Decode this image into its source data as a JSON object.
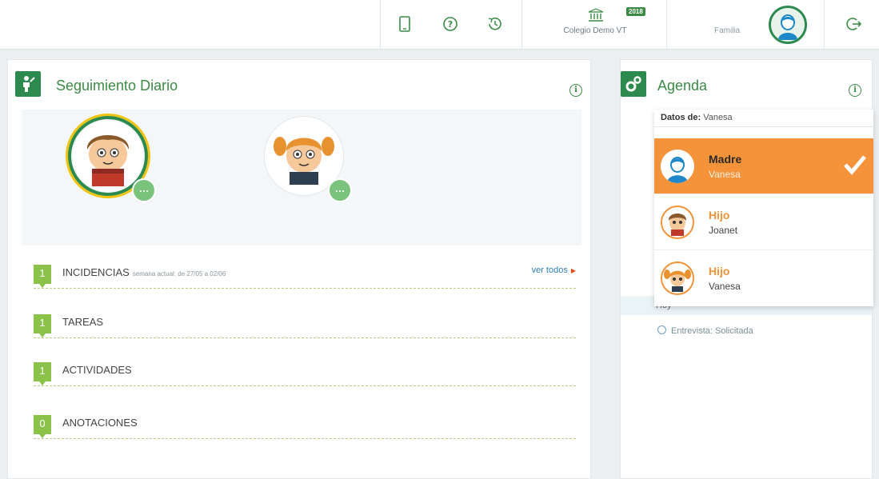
{
  "topbar": {
    "school_name": "Colegio Demo VT",
    "year_badge": "2018",
    "user_role": "Familia",
    "icons": [
      "tablet-icon",
      "help-icon",
      "history-icon",
      "school-icon",
      "avatar",
      "logout-icon"
    ]
  },
  "seguimiento": {
    "title": "Seguimiento Diario",
    "kids_bubble": "…",
    "sections": [
      {
        "count": "1",
        "label": "INCIDENCIAS",
        "sub": "semana actual: de 27/05 a 02/06",
        "link": "ver todos"
      },
      {
        "count": "1",
        "label": "TAREAS"
      },
      {
        "count": "1",
        "label": "ACTIVIDADES"
      },
      {
        "count": "0",
        "label": "ANOTACIONES"
      }
    ]
  },
  "agenda": {
    "title": "Agenda",
    "hoy": "Hoy",
    "event": "Entrevista: Solicitada"
  },
  "dropdown": {
    "header_label": "Datos de:",
    "header_value": "Vanesa",
    "items": [
      {
        "role": "Madre",
        "name": "Vanesa",
        "selected": true
      },
      {
        "role": "Hijo",
        "name": "Joanet"
      },
      {
        "role": "Hijo",
        "name": "Vanesa"
      }
    ]
  },
  "colors": {
    "green": "#2d8a4e",
    "orange": "#f4933a",
    "badge": "#8bc34a"
  }
}
